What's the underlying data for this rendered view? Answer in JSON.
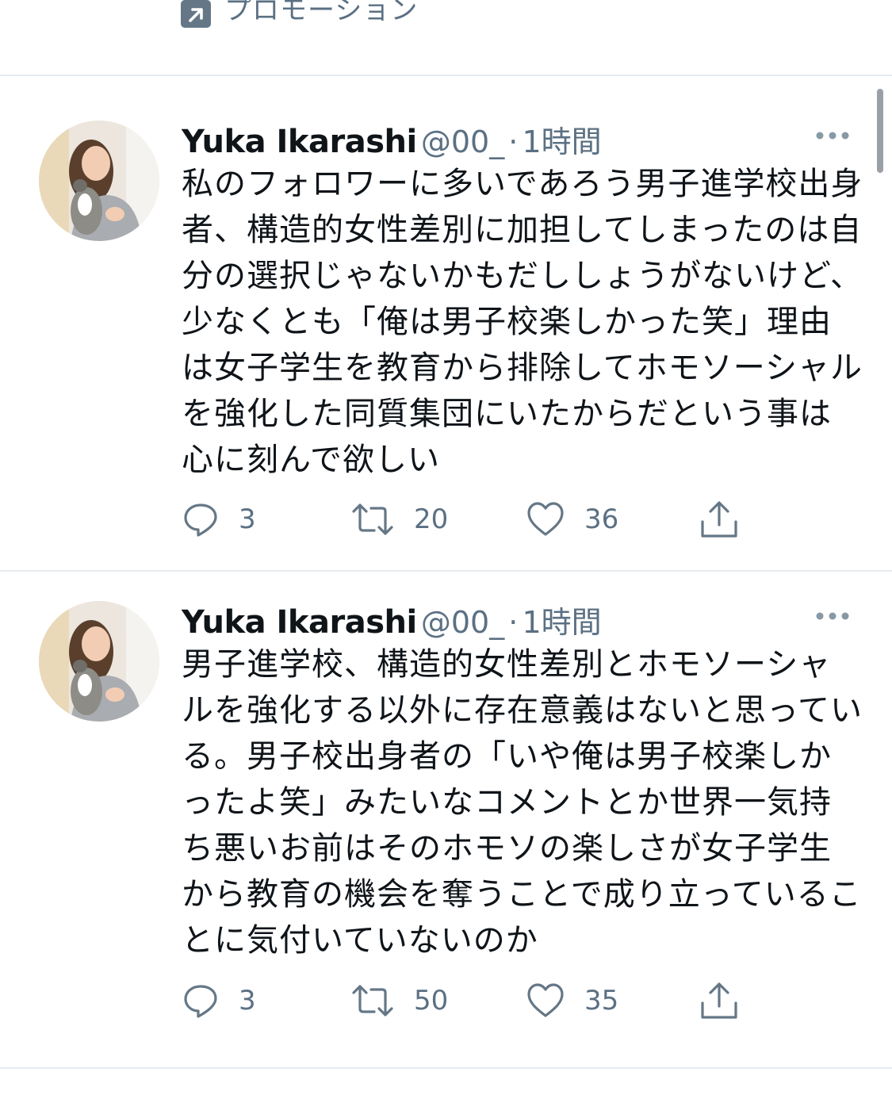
{
  "promo": {
    "label": "プロモーション",
    "icon": "promoted-arrow-icon"
  },
  "tweets": [
    {
      "name": "Yuka Ikarashi",
      "handle": "@00_",
      "dot": "·",
      "time": "1時間",
      "text": "私のフォロワーに多いであろう男子進学校出身者、構造的女性差別に加担してしまったのは自分の選択じゃないかもだししょうがないけど、少なくとも「俺は男子校楽しかった笑」理由は女子学生を教育から排除してホモソーシャルを強化した同質集団にいたからだという事は心に刻んで欲しい",
      "replies": "3",
      "retweets": "20",
      "likes": "36"
    },
    {
      "name": "Yuka Ikarashi",
      "handle": "@00_",
      "dot": "·",
      "time": "1時間",
      "text": "男子進学校、構造的女性差別とホモソーシャルを強化する以外に存在意義はないと思っている。男子校出身者の「いや俺は男子校楽しかったよ笑」みたいなコメントとか世界一気持ち悪いお前はそのホモソの楽しさが女子学生から教育の機会を奪うことで成り立っていることに気付いていないのか",
      "replies": "3",
      "retweets": "50",
      "likes": "35"
    }
  ],
  "colors": {
    "text": "#0f1419",
    "secondary": "#5b7083",
    "divider": "#e6ecf0"
  }
}
